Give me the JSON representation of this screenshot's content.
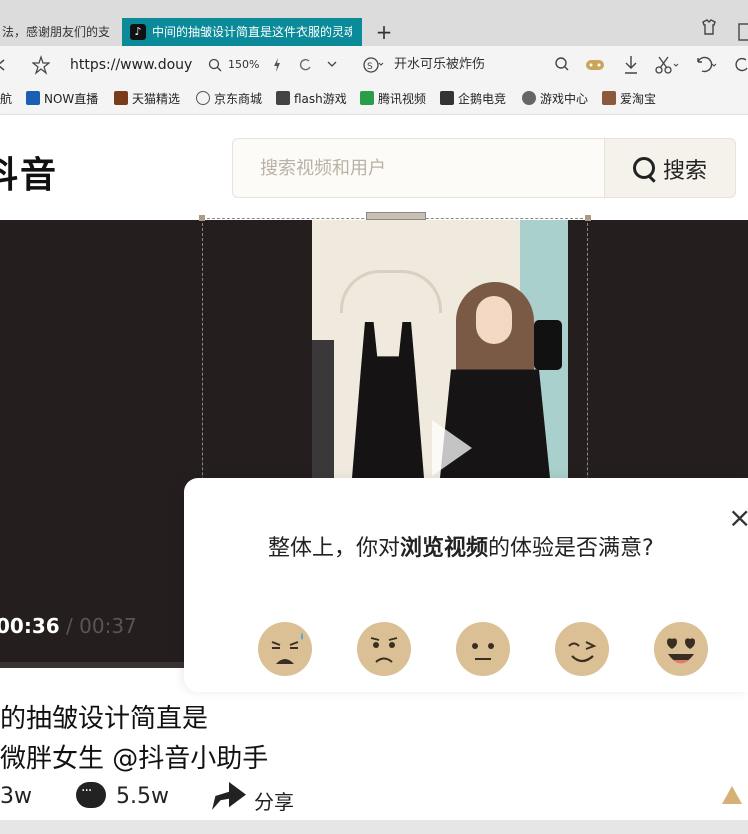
{
  "browser": {
    "tabs": [
      {
        "label": "法，感谢朋友们的支"
      },
      {
        "label": "中间的抽皱设计简直是这件衣服的灵魂"
      }
    ],
    "new_tab": "+",
    "address": {
      "url": "https://www.douy",
      "zoom": "150%",
      "search_text": "开水可乐被炸伤"
    },
    "bookmarks": [
      {
        "label": "航",
        "color": "#8a8a8a"
      },
      {
        "label": "NOW直播",
        "color": "#1a5fb4"
      },
      {
        "label": "天猫精选",
        "color": "#7a3b1b"
      },
      {
        "label": "京东商城",
        "color": "#c0392b"
      },
      {
        "label": "flash游戏",
        "color": "#333333"
      },
      {
        "label": "腾讯视频",
        "color": "#2a9d48"
      },
      {
        "label": "企鹅电竞",
        "color": "#333333"
      },
      {
        "label": "游戏中心",
        "color": "#5a5a5a"
      },
      {
        "label": "爱淘宝",
        "color": "#8a5a3a"
      }
    ]
  },
  "header": {
    "logo": "抖音",
    "search_placeholder": "搜索视频和用户",
    "search_button": "搜索"
  },
  "player": {
    "current_time": "00:36",
    "separator": " / ",
    "total_time": "00:37"
  },
  "video_info": {
    "title_line1": "的抽皱设计简直是",
    "title_line2": "微胖女生 @抖音小助手",
    "likes": "3w",
    "comments": "5.5w",
    "share": "分享"
  },
  "survey": {
    "question_prefix": "整体上，你对",
    "question_bold": "浏览视频",
    "question_suffix": "的体验是否满意?",
    "close": "×",
    "faces": [
      {
        "name": "very-dissatisfied"
      },
      {
        "name": "dissatisfied"
      },
      {
        "name": "neutral"
      },
      {
        "name": "satisfied"
      },
      {
        "name": "very-satisfied"
      }
    ],
    "face_color": "#dbbf95"
  }
}
